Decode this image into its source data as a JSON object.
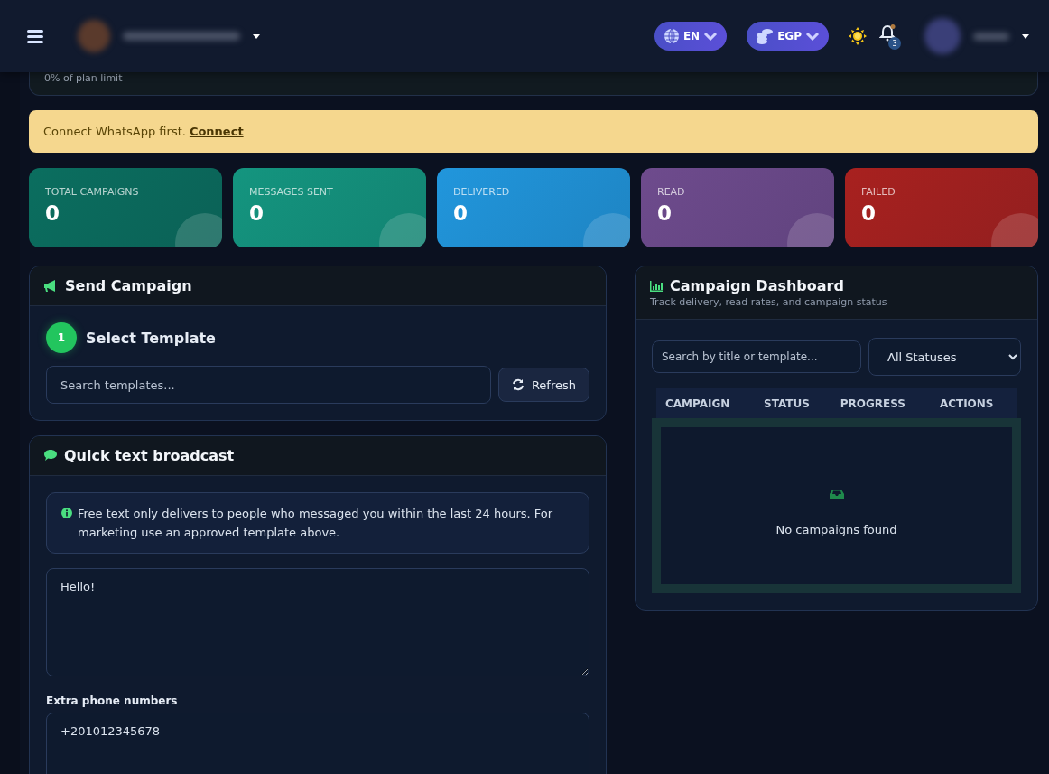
{
  "header": {
    "language": "EN",
    "currency": "EGP",
    "notifications": "3"
  },
  "usage": {
    "caption": "0% of plan limit"
  },
  "alert": {
    "text": "Connect WhatsApp first.",
    "link": "Connect"
  },
  "stats": [
    {
      "label": "TOTAL CAMPAIGNS",
      "value": "0",
      "color": "#0b6e5f"
    },
    {
      "label": "MESSAGES SENT",
      "value": "0",
      "color": "#14957f"
    },
    {
      "label": "DELIVERED",
      "value": "0",
      "color": "#2196dc"
    },
    {
      "label": "READ",
      "value": "0",
      "color": "#6e4b8d"
    },
    {
      "label": "FAILED",
      "value": "0",
      "color": "#a8211f"
    }
  ],
  "send_campaign": {
    "title": "Send Campaign",
    "step": {
      "number": "1",
      "title": "Select Template"
    },
    "search": {
      "placeholder": "Search templates..."
    },
    "refresh_button": "Refresh"
  },
  "quick_broadcast": {
    "title": "Quick text broadcast",
    "info": "Free text only delivers to people who messaged you within the last 24 hours. For marketing use an approved template above.",
    "message": {
      "value": "Hello!"
    },
    "extra_phones": {
      "label": "Extra phone numbers",
      "value": "+201012345678"
    }
  },
  "dashboard": {
    "title": "Campaign Dashboard",
    "subtitle": "Track delivery, read rates, and campaign status",
    "search": {
      "placeholder": "Search by title or template..."
    },
    "status_filter": "All Statuses",
    "table": {
      "columns": [
        "CAMPAIGN",
        "STATUS",
        "PROGRESS",
        "ACTIONS"
      ],
      "empty": "No campaigns found"
    }
  }
}
